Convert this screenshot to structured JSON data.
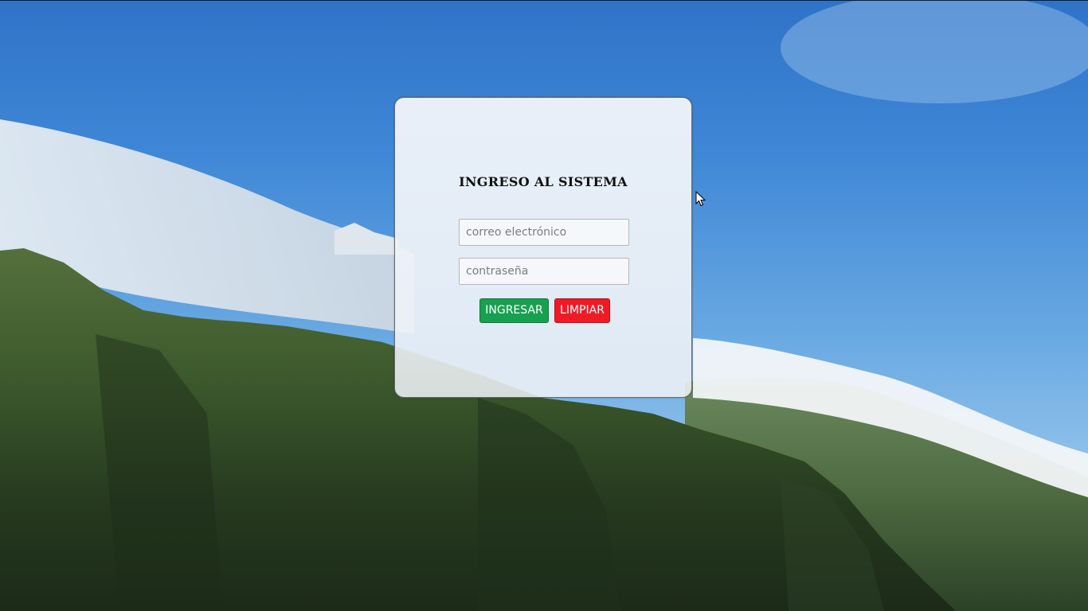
{
  "login": {
    "title": "INGRESO AL SISTEMA",
    "email_placeholder": "correo electrónico",
    "password_placeholder": "contraseña",
    "submit_label": "INGRESAR",
    "clear_label": "LIMPIAR"
  },
  "colors": {
    "submit_button": "#17a04f",
    "clear_button": "#ee1b24",
    "sky": "#3f87d6"
  }
}
